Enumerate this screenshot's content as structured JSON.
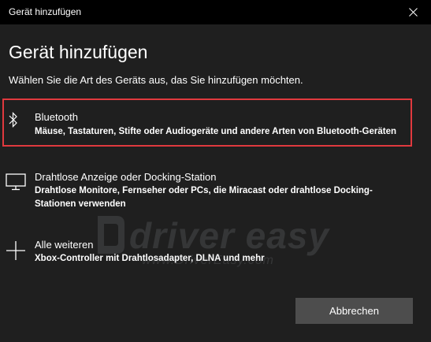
{
  "window": {
    "title": "Gerät hinzufügen"
  },
  "heading": "Gerät hinzufügen",
  "instruction": "Wählen Sie die Art des Geräts aus, das Sie hinzufügen möchten.",
  "options": [
    {
      "icon": "bluetooth-icon",
      "title": "Bluetooth",
      "description": "Mäuse, Tastaturen, Stifte oder Audiogeräte und andere Arten von Bluetooth-Geräten",
      "highlighted": true
    },
    {
      "icon": "monitor-icon",
      "title": "Drahtlose Anzeige oder Docking-Station",
      "description": "Drahtlose Monitore, Fernseher oder PCs, die Miracast oder drahtlose Docking-Stationen verwenden"
    },
    {
      "icon": "plus-icon",
      "title": "Alle weiteren",
      "description": "Xbox-Controller mit Drahtlosadapter, DLNA und mehr"
    }
  ],
  "watermark": {
    "brand": "driver easy",
    "url": "www.DriverEasy.com"
  },
  "buttons": {
    "cancel": "Abbrechen"
  },
  "colors": {
    "background": "#1f1f1f",
    "titlebar": "#000000",
    "highlight_border": "#e0393e",
    "button": "#4d4d4d"
  }
}
